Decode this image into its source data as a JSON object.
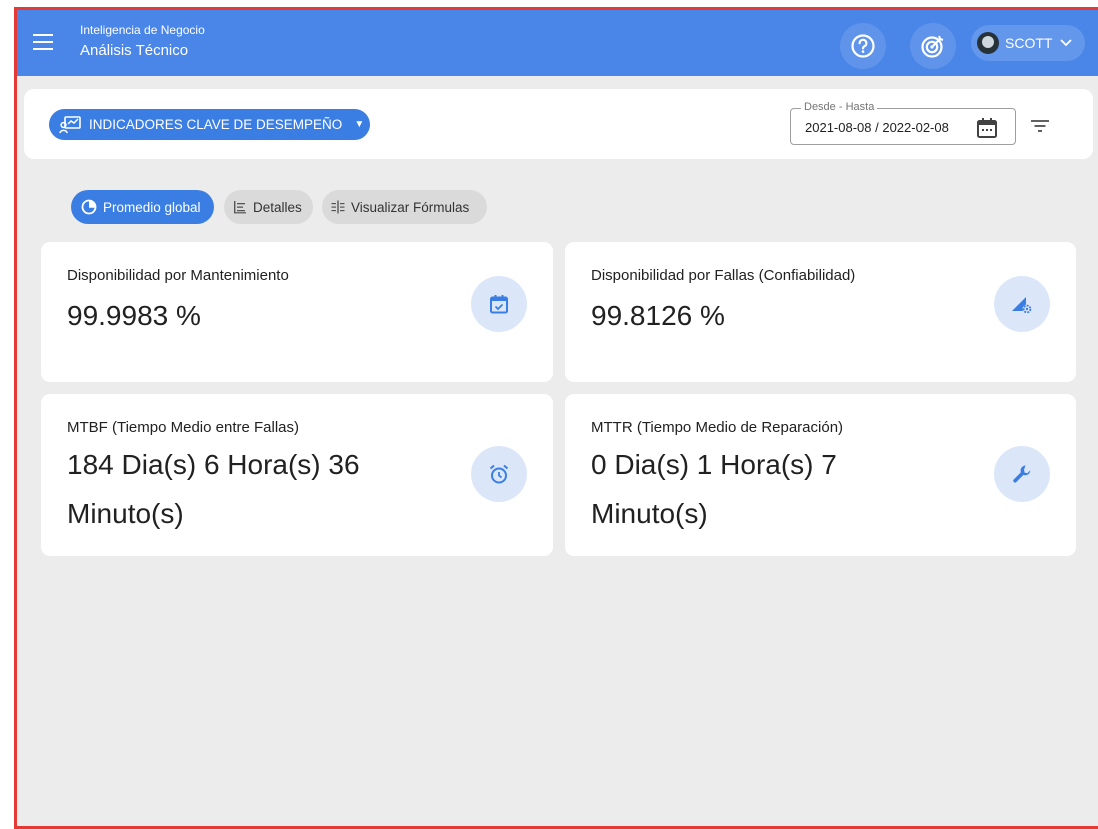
{
  "header": {
    "subtitle": "Inteligencia de Negocio",
    "title": "Análisis Técnico",
    "user_name": "SCOTT",
    "icons": [
      "menu-icon",
      "help-icon",
      "target-icon",
      "chevron-down-icon"
    ]
  },
  "filters": {
    "kpi_button_label": "INDICADORES CLAVE DE DESEMPEÑO",
    "date_label": "Desde - Hasta",
    "date_value": "2021-08-08 / 2022-02-08"
  },
  "tabs": [
    {
      "label": "Promedio global",
      "active": true,
      "icon": "pie-chart-icon"
    },
    {
      "label": "Detalles",
      "active": false,
      "icon": "list-icon"
    },
    {
      "label": "Visualizar Fórmulas",
      "active": false,
      "icon": "formula-icon"
    }
  ],
  "kpis": [
    {
      "label": "Disponibilidad por Mantenimiento",
      "value_line1": "99.9983 %",
      "value_line2": "",
      "icon": "calendar-check-icon"
    },
    {
      "label": "Disponibilidad por Fallas (Confiabilidad)",
      "value_line1": "99.8126 %",
      "value_line2": "",
      "icon": "signal-gear-icon"
    },
    {
      "label": "MTBF (Tiempo Medio entre Fallas)",
      "value_line1": "184 Dia(s) 6 Hora(s) 36",
      "value_line2": "Minuto(s)",
      "icon": "alarm-icon"
    },
    {
      "label": "MTTR (Tiempo Medio de Reparación)",
      "value_line1": "0 Dia(s) 1 Hora(s) 7",
      "value_line2": "Minuto(s)",
      "icon": "wrench-icon"
    }
  ],
  "colors": {
    "header_bg": "#4a86e8",
    "accent": "#3b7ee3",
    "icon_circle": "#dbe7f9",
    "page_bg": "#ececec",
    "frame": "#e53935"
  }
}
